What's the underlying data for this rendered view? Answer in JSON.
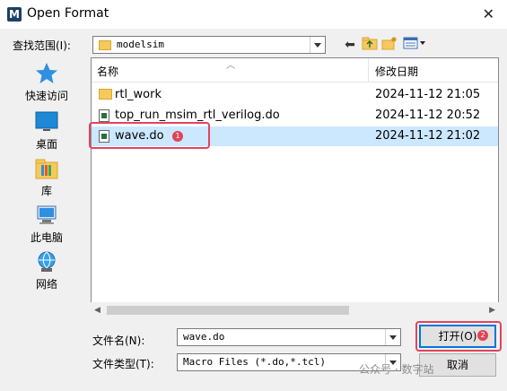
{
  "window": {
    "title": "Open Format",
    "app_icon_letter": "M"
  },
  "lookin": {
    "label": "查找范围(I):",
    "value": "modelsim"
  },
  "places": [
    {
      "label": "快速访问",
      "icon": "star-icon"
    },
    {
      "label": "桌面",
      "icon": "desktop-icon"
    },
    {
      "label": "库",
      "icon": "library-folder-icon"
    },
    {
      "label": "此电脑",
      "icon": "computer-icon"
    },
    {
      "label": "网络",
      "icon": "network-icon"
    }
  ],
  "filelist": {
    "col_name": "名称",
    "col_date": "修改日期",
    "rows": [
      {
        "name": "rtl_work",
        "date": "2024-11-12 21:05",
        "type": "folder"
      },
      {
        "name": "top_run_msim_rtl_verilog.do",
        "date": "2024-11-12 20:52",
        "type": "file"
      },
      {
        "name": "wave.do",
        "date": "2024-11-12 21:02",
        "type": "file",
        "selected": true
      }
    ]
  },
  "annotations": {
    "badge1": "1",
    "badge2": "2"
  },
  "filename": {
    "label": "文件名(N):",
    "value": "wave.do"
  },
  "filetype": {
    "label": "文件类型(T):",
    "value": "Macro Files (*.do,*.tcl)"
  },
  "buttons": {
    "open": "打开(O)",
    "cancel": "取消"
  },
  "watermark": "公众号 · 数字站",
  "colors": {
    "selection": "#cce8ff",
    "highlight_border": "#e0455a",
    "accent": "#0078d7"
  }
}
